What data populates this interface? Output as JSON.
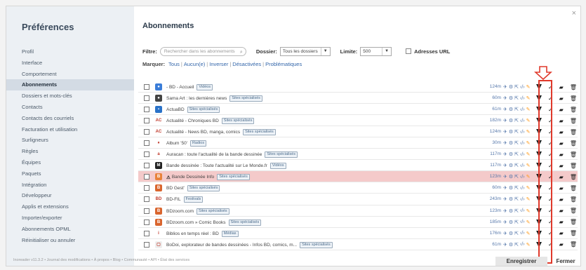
{
  "window": {
    "close_glyph": "×"
  },
  "sidebar": {
    "title": "Préférences",
    "items": [
      {
        "label": "Profil",
        "active": false
      },
      {
        "label": "Interface",
        "active": false
      },
      {
        "label": "Comportement",
        "active": false
      },
      {
        "label": "Abonnements",
        "active": true
      },
      {
        "label": "Dossiers et mots-clés",
        "active": false
      },
      {
        "label": "Contacts",
        "active": false
      },
      {
        "label": "Contacts des courriels",
        "active": false
      },
      {
        "label": "Facturation et utilisation",
        "active": false
      },
      {
        "label": "Surligneurs",
        "active": false
      },
      {
        "label": "Règles",
        "active": false
      },
      {
        "label": "Équipes",
        "active": false
      },
      {
        "label": "Paquets",
        "active": false
      },
      {
        "label": "Intégration",
        "active": false
      },
      {
        "label": "Développeur",
        "active": false
      },
      {
        "label": "Applis et extensions",
        "active": false
      },
      {
        "label": "Importer/exporter",
        "active": false
      },
      {
        "label": "Abonnements OPML",
        "active": false
      },
      {
        "label": "Réinitialiser ou annuler",
        "active": false
      }
    ]
  },
  "main": {
    "title": "Abonnements",
    "filter": {
      "label": "Filtre:",
      "placeholder": "Rechercher dans les abonnements",
      "folder_label": "Dossier:",
      "folder_value": "Tous les dossiers",
      "limit_label": "Limite:",
      "limit_value": "500",
      "urls_label": "Adresses URL"
    },
    "mark": {
      "label": "Marquer:",
      "links": [
        "Tous",
        "Aucun(e)",
        "Inverser",
        "Désactivées",
        "Problématiques"
      ]
    },
    "feeds": [
      {
        "title": "- BD - Accueil",
        "tag": "Vidéos",
        "stat": "124m",
        "icon": "globe-icon",
        "fav_color": "#3b7dd8",
        "fav_text": "●",
        "highlight": false,
        "warn": false
      },
      {
        "title": "Sama Art : les dernières news",
        "tag": "Sites spécialisés",
        "stat": "60m",
        "icon": "round-icon",
        "fav_color": "#444444",
        "fav_text": "●",
        "highlight": false,
        "warn": false
      },
      {
        "title": "ActuaBD",
        "tag": "Sites spécialisés",
        "stat": "61m",
        "icon": "square-icon",
        "fav_color": "#2a72c8",
        "fav_text": "▪",
        "highlight": false,
        "warn": false
      },
      {
        "title": "Actualité - Chroniques BD",
        "tag": "Sites spécialisés",
        "stat": "182m",
        "icon": "ac-logo-icon",
        "fav_color": "#ffffff",
        "fav_text": "AC",
        "highlight": false,
        "warn": false
      },
      {
        "title": "Actualité - News BD, manga, comics",
        "tag": "Sites spécialisés",
        "stat": "124m",
        "icon": "ac-logo-icon",
        "fav_color": "#ffffff",
        "fav_text": "AC",
        "highlight": false,
        "warn": false
      },
      {
        "title": "Album '50'",
        "tag": "Radios",
        "stat": "30m",
        "icon": "pin-icon",
        "fav_color": "#ffffff",
        "fav_text": "♦",
        "highlight": false,
        "warn": false
      },
      {
        "title": "Auracan : toute l'actualité de la bande dessinée",
        "tag": "Sites spécialisés",
        "stat": "117m",
        "icon": "a-logo-icon",
        "fav_color": "#ffffff",
        "fav_text": "a",
        "highlight": false,
        "warn": false
      },
      {
        "title": "Bande dessinée : Toute l'actualité sur Le Monde.fr",
        "tag": "Vidéos",
        "stat": "117m",
        "icon": "m-logo-icon",
        "fav_color": "#222222",
        "fav_text": "M",
        "highlight": false,
        "warn": false
      },
      {
        "title": "Bande Dessinée Info",
        "tag": "Sites spécialisés",
        "stat": "123m",
        "icon": "bdi-logo-icon",
        "fav_color": "#e8823a",
        "fav_text": "B",
        "highlight": true,
        "warn": true
      },
      {
        "title": "BD Gest'",
        "tag": "Sites spécialisés",
        "stat": "60m",
        "icon": "bdgest-logo-icon",
        "fav_color": "#d9652e",
        "fav_text": "B",
        "highlight": false,
        "warn": false
      },
      {
        "title": "BD-FIL",
        "tag": "Festivals",
        "stat": "243m",
        "icon": "bdfil-logo-icon",
        "fav_color": "#ffffff",
        "fav_text": "BD",
        "highlight": false,
        "warn": false
      },
      {
        "title": "BDzoom.com",
        "tag": "Sites spécialisés",
        "stat": "123m",
        "icon": "bdzoom-logo-icon",
        "fav_color": "#d9652e",
        "fav_text": "B",
        "highlight": false,
        "warn": false
      },
      {
        "title": "BDzoom.com » Comic Books",
        "tag": "Sites spécialisés",
        "stat": "185m",
        "icon": "bdzoom-logo-icon",
        "fav_color": "#d9652e",
        "fav_text": "B",
        "highlight": false,
        "warn": false
      },
      {
        "title": "Biblios en temps réel : BD",
        "tag": "Médias",
        "stat": "176m",
        "icon": "i-logo-icon",
        "fav_color": "#ffffff",
        "fav_text": "i",
        "highlight": false,
        "warn": false
      },
      {
        "title": "BoDoi, explorateur de bandes dessinées - Infos BD, comics, m...",
        "tag": "Sites spécialisés",
        "stat": "61m",
        "icon": "bodoi-logo-icon",
        "fav_color": "#eeeeee",
        "fav_text": "▢",
        "highlight": false,
        "warn": false
      }
    ]
  },
  "footer": {
    "text": "Inoreader v11.3.2 • Journal des modifications • À propos • Blog • Communauté • API • État des services",
    "save_label": "Enregistrer",
    "close_label": "Fermer"
  },
  "colors": {
    "accent_link": "#3366aa",
    "highlight_row": "#f4caca",
    "annotation_red": "#e0392b",
    "edit_pencil": "#ff9a1a"
  }
}
